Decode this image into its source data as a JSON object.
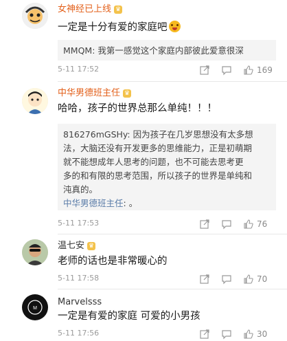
{
  "comments": [
    {
      "username": "女神经已上线",
      "text": "一定是十分有爱的家庭吧",
      "replies": [
        {
          "author": "MMQM",
          "text": "MMQM: 我第一感觉这个家庭内部彼此爱意很深"
        }
      ],
      "time": "5-11 17:52",
      "likes": "169"
    },
    {
      "username": "中华男德班主任",
      "text": "哈哈，孩子的世界总那么单纯！！！",
      "reply_lines": [
        "816276mGSHy: 因为孩子在几岁思想没有太多想",
        "法，大脑还没有开发更多的思维能力，正是初萌期",
        "就不能想成年人思考的问题，也不可能去思考更",
        "多的和有限的思考范围，所以孩子的世界是单纯和",
        "沌真的。"
      ],
      "reply2_author": "中华男德班主任",
      "reply2_text": ": 。",
      "time": "5-11 17:53",
      "likes": "76"
    },
    {
      "username": "温七安",
      "text": "老师的话也是非常暖心的",
      "time": "5-11 17:58",
      "likes": "70"
    },
    {
      "username": "Marvelsss",
      "text": "一定是有爱的家庭 可爱的小男孩",
      "time": "5-11 17:56",
      "likes": "30"
    }
  ],
  "icons": {
    "share": "share-icon",
    "comment": "comment-icon",
    "like": "thumbs-up-icon",
    "badge": "vip-badge-icon"
  },
  "colors": {
    "username_accent": "#e3611c",
    "reply_name": "#5a7ca8",
    "meta_gray": "#9a9a9a",
    "reply_bg": "#f4f4f4"
  }
}
